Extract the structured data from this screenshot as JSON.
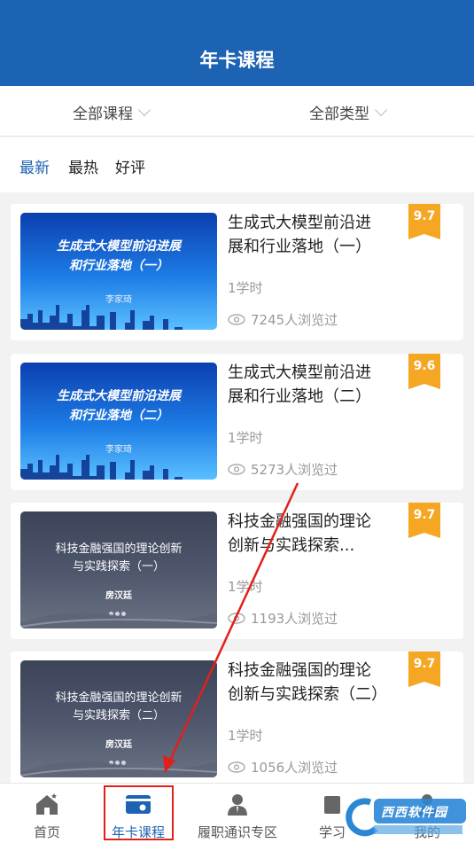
{
  "header": {
    "title": "年卡课程"
  },
  "filters": {
    "all_courses": "全部课程",
    "all_types": "全部类型"
  },
  "sort": {
    "newest": "最新",
    "hottest": "最热",
    "top_rated": "好评"
  },
  "courses": [
    {
      "title_line1": "生成式大模型前沿进",
      "title_line2": "展和行业落地（一）",
      "hours": "1学时",
      "views": "7245人浏览过",
      "score": "9.7",
      "thumb_title1": "生成式大模型前沿进展",
      "thumb_title2": "和行业落地（一）",
      "thumb_author": "李家琦"
    },
    {
      "title_line1": "生成式大模型前沿进",
      "title_line2": "展和行业落地（二）",
      "hours": "1学时",
      "views": "5273人浏览过",
      "score": "9.6",
      "thumb_title1": "生成式大模型前沿进展",
      "thumb_title2": "和行业落地（二）",
      "thumb_author": "李家琦"
    },
    {
      "title_line1": "科技金融强国的理论",
      "title_line2": "创新与实践探索...",
      "hours": "1学时",
      "views": "1193人浏览过",
      "score": "9.7",
      "thumb_title1": "科技金融强国的理论创新",
      "thumb_title2": "与实践探索（一）",
      "thumb_author": "房汉廷"
    },
    {
      "title_line1": "科技金融强国的理论",
      "title_line2": "创新与实践探索（二）",
      "hours": "1学时",
      "views": "1056人浏览过",
      "score": "9.7",
      "thumb_title1": "科技金融强国的理论创新",
      "thumb_title2": "与实践探索（二）",
      "thumb_author": "房汉廷"
    }
  ],
  "tabbar": {
    "home": "首页",
    "annual_card": "年卡课程",
    "duty_zone": "履职通识专区",
    "study": "学习",
    "mine": "我的"
  },
  "watermark": {
    "text": "西西软件园"
  },
  "colors": {
    "brand": "#1d63b3",
    "score_badge": "#f5a623",
    "highlight": "#e0211b"
  }
}
